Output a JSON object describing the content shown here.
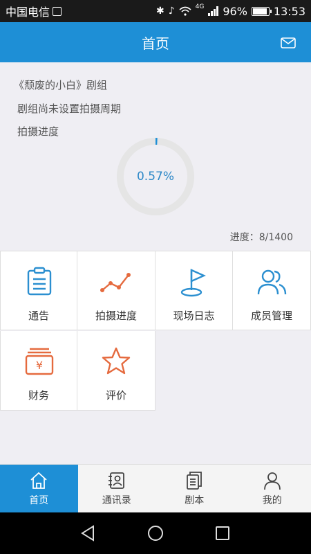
{
  "status_bar": {
    "carrier": "中国电信",
    "network": "4G",
    "battery": "96%",
    "battery_level": 0.96,
    "time": "13:53"
  },
  "header": {
    "title": "首页",
    "mail_icon": "mail-icon"
  },
  "info": {
    "crew_name": "《颓废的小白》剧组",
    "period": "剧组尚未设置拍摄周期",
    "progress_label": "拍摄进度",
    "percent_text": "0.57%",
    "percent_value": 0.0057,
    "progress_count": "进度：8/1400"
  },
  "grid": {
    "tiles": [
      {
        "label": "通告",
        "icon": "clipboard-icon"
      },
      {
        "label": "拍摄进度",
        "icon": "trend-line-icon"
      },
      {
        "label": "现场日志",
        "icon": "flag-icon"
      },
      {
        "label": "成员管理",
        "icon": "members-icon"
      },
      {
        "label": "财务",
        "icon": "finance-icon"
      },
      {
        "label": "评价",
        "icon": "star-icon"
      }
    ]
  },
  "colors": {
    "primary": "#1e8fd6",
    "blue_icon": "#2b8fd0",
    "orange_icon": "#e56a3e",
    "ring_track": "#e5e5e5"
  },
  "bottom_nav": {
    "items": [
      {
        "label": "首页",
        "icon": "home-icon",
        "active": true
      },
      {
        "label": "通讯录",
        "icon": "contacts-icon",
        "active": false
      },
      {
        "label": "剧本",
        "icon": "script-icon",
        "active": false
      },
      {
        "label": "我的",
        "icon": "profile-icon",
        "active": false
      }
    ]
  }
}
